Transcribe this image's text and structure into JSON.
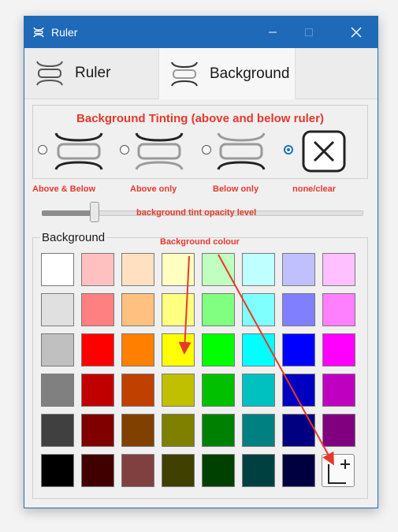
{
  "window": {
    "title": "Ruler"
  },
  "tabs": [
    {
      "label": "Ruler"
    },
    {
      "label": "Background"
    }
  ],
  "tinting": {
    "title": "Background Tinting (above and below ruler)",
    "options": [
      {
        "label": "Above & Below",
        "selected": false
      },
      {
        "label": "Above only",
        "selected": false
      },
      {
        "label": "Below only",
        "selected": false
      },
      {
        "label": "none/clear",
        "selected": true
      }
    ]
  },
  "opacity": {
    "caption": "background tint opacity level",
    "value_fraction": 0.17
  },
  "background_group": {
    "title": "Background",
    "caption": "Background colour",
    "palette": [
      [
        "#ffffff",
        "#ffc0c0",
        "#ffe0c0",
        "#ffffc0",
        "#c0ffc0",
        "#c0ffff",
        "#c0c0ff",
        "#ffc0ff"
      ],
      [
        "#e0e0e0",
        "#ff8080",
        "#ffc080",
        "#ffff80",
        "#80ff80",
        "#80ffff",
        "#8080ff",
        "#ff80ff"
      ],
      [
        "#c0c0c0",
        "#ff0000",
        "#ff8000",
        "#ffff00",
        "#00ff00",
        "#00ffff",
        "#0000ff",
        "#ff00ff"
      ],
      [
        "#808080",
        "#c00000",
        "#c04000",
        "#c0c000",
        "#00c000",
        "#00c0c0",
        "#0000c0",
        "#c000c0"
      ],
      [
        "#404040",
        "#800000",
        "#804000",
        "#808000",
        "#008000",
        "#008080",
        "#000080",
        "#800080"
      ],
      [
        "#000000",
        "#400000",
        "#804040",
        "#404000",
        "#004000",
        "#004040",
        "#000040"
      ]
    ],
    "custom_button_icon": "plus-icon"
  },
  "colors": {
    "accent": "#1e69b8",
    "annotation": "#e5392b"
  }
}
